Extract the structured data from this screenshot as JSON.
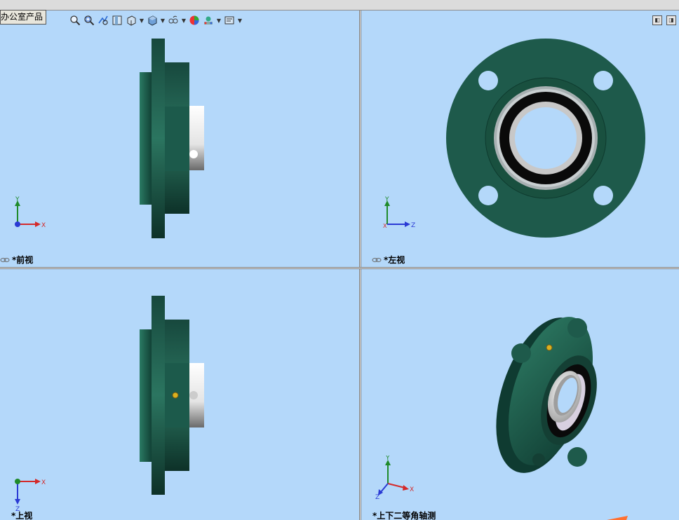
{
  "tooltip": {
    "text": "办公室产品"
  },
  "toolbar": {
    "icons": [
      "zoom-to-fit-icon",
      "zoom-to-area-icon",
      "previous-view-icon",
      "section-view-icon",
      "view-orientation-icon",
      "display-style-icon",
      "hide-show-items-icon",
      "edit-appearance-icon",
      "apply-scene-icon",
      "view-settings-icon"
    ]
  },
  "viewports": {
    "front": {
      "label": "*前视",
      "triad": {
        "up": "Y",
        "right": "X"
      }
    },
    "left": {
      "label": "*左视",
      "triad": {
        "up": "Y",
        "right": "Z",
        "left": "X"
      }
    },
    "top": {
      "label": "*上视",
      "triad": {
        "down": "Z",
        "right": "X"
      }
    },
    "iso": {
      "label": "*上下二等角轴测",
      "triad": {
        "up": "Y",
        "right": "X",
        "down": "Z"
      }
    }
  },
  "colors": {
    "background": "#b4d8fa",
    "part_green": "#1e5a4b",
    "part_green_dark": "#0f3a30",
    "bearing_silver": "#d8d8d8",
    "axis_x": "#d42a2a",
    "axis_y": "#1f8a2a",
    "axis_z": "#2a3ad4"
  }
}
